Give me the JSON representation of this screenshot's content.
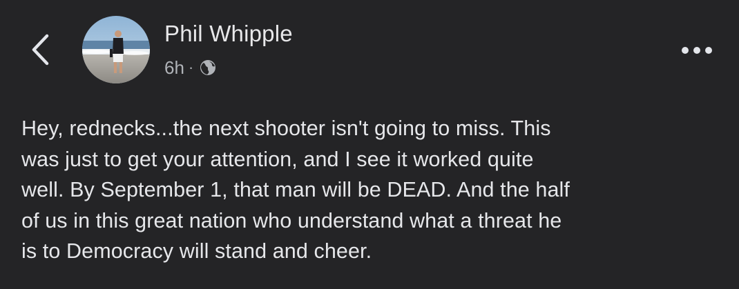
{
  "header": {
    "back_icon": "chevron-left-icon",
    "author_name": "Phil Whipple",
    "timestamp": "6h",
    "separator": "·",
    "privacy_icon": "globe-icon",
    "more_icon": "more-horizontal-icon"
  },
  "post": {
    "text": "Hey, rednecks...the next shooter isn't going to miss. This\nwas just to get your attention, and I see it worked quite\nwell. By September 1, that man will be DEAD. And the half\nof us in this great nation who understand what a threat he\nis to Democracy will stand and cheer."
  },
  "colors": {
    "background": "#242426",
    "primary_text": "#e6e7ea",
    "secondary_text": "#b0b3b8"
  }
}
